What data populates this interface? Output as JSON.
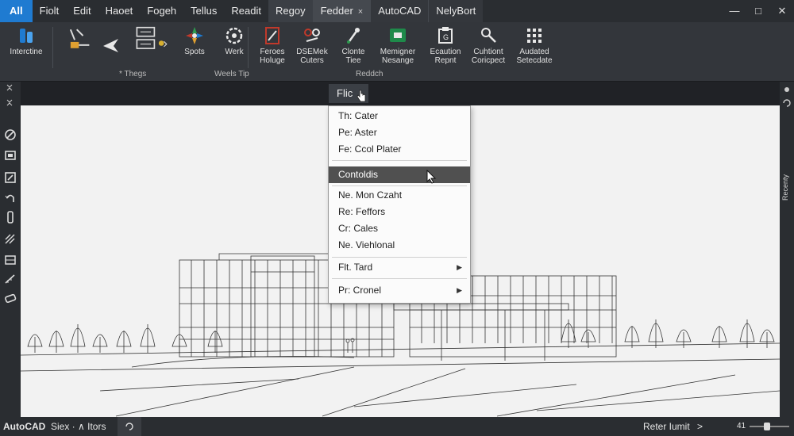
{
  "menubar": {
    "items": [
      {
        "label": "All",
        "kind": "app"
      },
      {
        "label": "Fiolt",
        "kind": "menu"
      },
      {
        "label": "Edit",
        "kind": "menu"
      },
      {
        "label": "Haoet",
        "kind": "menu"
      },
      {
        "label": "Fogeh",
        "kind": "menu"
      },
      {
        "label": "Tellus",
        "kind": "menu"
      },
      {
        "label": "Readit",
        "kind": "menu"
      },
      {
        "label": "Regoy",
        "kind": "active"
      }
    ],
    "tabs": [
      {
        "label": "Fedder",
        "close": "×"
      },
      {
        "label": "AutoCAD",
        "close": ""
      },
      {
        "label": "NelyBort",
        "close": ""
      }
    ],
    "window_controls": [
      "—",
      "□",
      "✕"
    ]
  },
  "ribbon": {
    "tools": [
      {
        "label": "Interctine",
        "icon": "interctine-icon"
      },
      {
        "label": "",
        "icon": "line-tools-icon"
      },
      {
        "label": "",
        "icon": "arrow-icon"
      },
      {
        "label": "",
        "icon": "properties-icon"
      },
      {
        "label": "Spots",
        "icon": "spots-icon"
      },
      {
        "label": "Werk",
        "icon": "werk-icon"
      },
      {
        "label": "Feroes\nHoluge",
        "icon": "feroes-icon"
      },
      {
        "label": "DSEMek\nCuters",
        "icon": "dsemek-icon"
      },
      {
        "label": "Clonte\nTiee",
        "icon": "clonte-icon"
      },
      {
        "label": "Memigner\nNesange",
        "icon": "memigner-icon"
      },
      {
        "label": "Ecaution\nRepnt",
        "icon": "ecaution-icon"
      },
      {
        "label": "Cuhtiont\nCoricpect",
        "icon": "cuhtiont-icon"
      },
      {
        "label": "Audated\nSetecdate",
        "icon": "audated-icon"
      }
    ],
    "panels": [
      "* Thegs",
      "Weels Tip",
      "Reddch"
    ],
    "colors": {
      "accent_blue": "#1f7bd1",
      "green": "#1e8a4a",
      "red": "#c0392b"
    }
  },
  "context": {
    "button_label": "Flic",
    "items": [
      {
        "label": "Th: Cater",
        "submenu": false
      },
      {
        "label": "Pe: Aster",
        "submenu": false
      },
      {
        "label": "Fe: Ccol Plater",
        "submenu": false
      },
      {
        "label": "Contoldis",
        "submenu": false,
        "highlight": true
      },
      {
        "label": "Ne. Mon Czaht",
        "submenu": false
      },
      {
        "label": "Re: Feffors",
        "submenu": false
      },
      {
        "label": "Cr: Cales",
        "submenu": false
      },
      {
        "label": "Ne. Viehlonal",
        "submenu": false
      },
      {
        "label": "Flt. Tard",
        "submenu": true
      },
      {
        "label": "Pr: Cronel",
        "submenu": true
      }
    ]
  },
  "right_toolbar": {
    "vertical_label": "Recenty"
  },
  "statusbar": {
    "app_label": "AutoCAD",
    "section_label": "Siex · ∧ Itors",
    "right_label": "Reter Iumit",
    "right_arrow": ">",
    "zoom_label": "41"
  }
}
